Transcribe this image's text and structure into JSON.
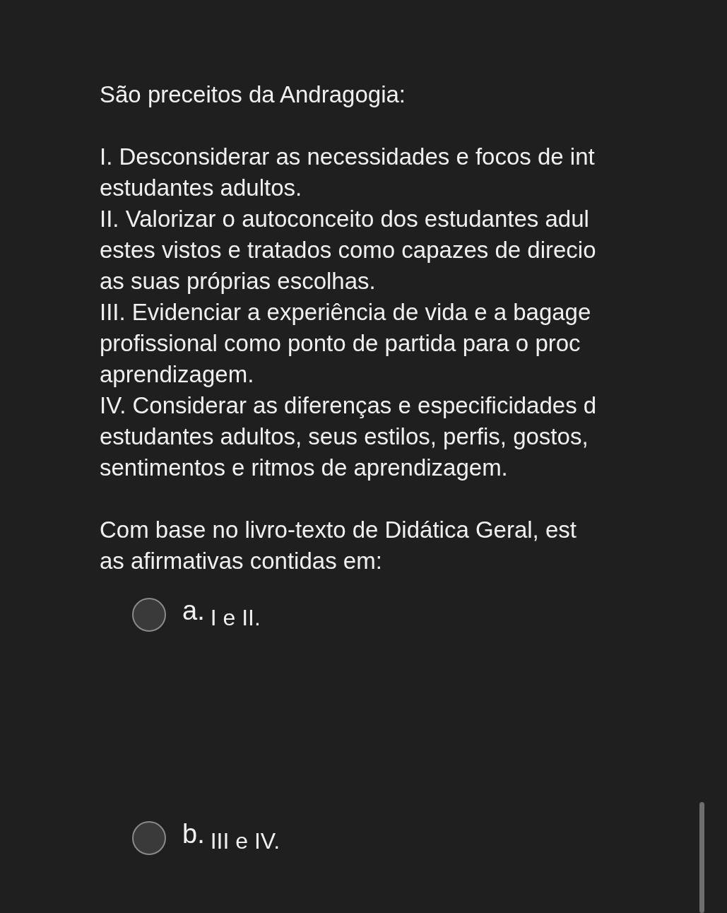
{
  "question": {
    "title": "São preceitos da Andragogia:",
    "statement_lines": [
      "I. Desconsiderar as necessidades e focos de int",
      "estudantes adultos.",
      "II. Valorizar o autoconceito dos estudantes adul",
      "estes vistos e tratados como capazes de direcio",
      "as suas próprias escolhas.",
      "III. Evidenciar a experiência de vida e a bagage",
      "profissional como ponto de partida para o proc",
      "aprendizagem.",
      "IV. Considerar as diferenças e especificidades d",
      "estudantes adultos, seus estilos, perfis, gostos,",
      "sentimentos e ritmos de aprendizagem."
    ],
    "prompt_lines": [
      "Com base no livro-texto de Didática Geral, est",
      "as afirmativas contidas em:"
    ]
  },
  "options": [
    {
      "letter": "a.",
      "text": "I e II.",
      "selected": false
    },
    {
      "letter": "b.",
      "text": "III e IV.",
      "selected": false
    }
  ]
}
